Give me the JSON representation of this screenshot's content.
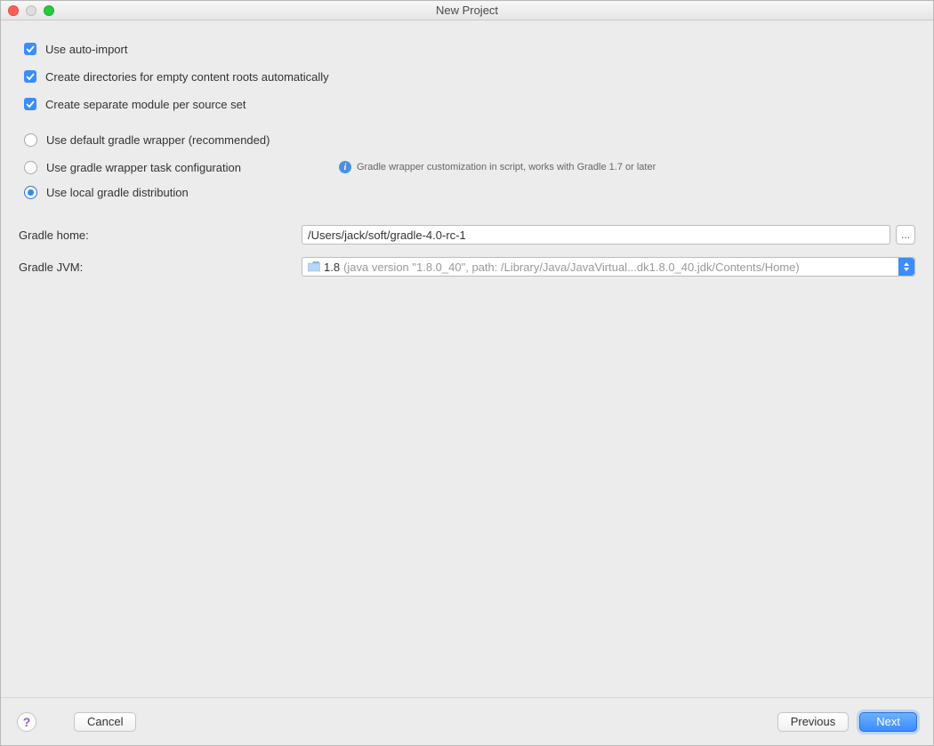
{
  "title": "New Project",
  "options": {
    "autoImport": "Use auto-import",
    "createDirs": "Create directories for empty content roots automatically",
    "separateModule": "Create separate module per source set",
    "defaultWrapper": "Use default gradle wrapper (recommended)",
    "wrapperTask": "Use gradle wrapper task configuration",
    "wrapperHint": "Gradle wrapper customization in script, works with Gradle 1.7 or later",
    "localDist": "Use local gradle distribution"
  },
  "form": {
    "gradleHomeLabel": "Gradle home:",
    "gradleHomeValue": "/Users/jack/soft/gradle-4.0-rc-1",
    "gradleJvmLabel": "Gradle JVM:",
    "gradleJvmPrimary": "1.8",
    "gradleJvmSecondary": "(java version \"1.8.0_40\", path: /Library/Java/JavaVirtual...dk1.8.0_40.jdk/Contents/Home)"
  },
  "buttons": {
    "help": "?",
    "cancel": "Cancel",
    "previous": "Previous",
    "next": "Next",
    "ellipsis": "..."
  }
}
